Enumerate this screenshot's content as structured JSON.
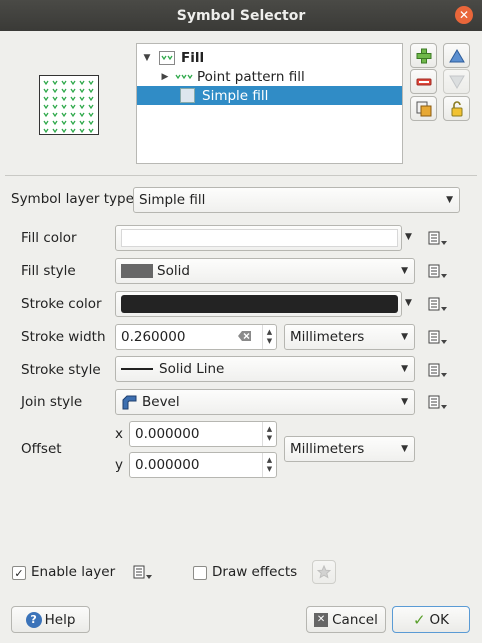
{
  "window": {
    "title": "Symbol Selector",
    "close_icon": "close-icon"
  },
  "tree": {
    "root_label": "Fill",
    "items": [
      {
        "label": "Point pattern fill",
        "icon": "point-pattern-icon"
      },
      {
        "label": "Simple fill",
        "icon": "simple-fill-icon",
        "selected": true
      }
    ]
  },
  "layer_buttons": [
    "add-layer-icon",
    "remove-layer-icon",
    "duplicate-layer-icon",
    "lock-icon",
    "move-up-icon",
    "move-down-icon"
  ],
  "symbol_layer_type": {
    "label": "Symbol layer type",
    "value": "Simple fill"
  },
  "fields": {
    "fill_color": {
      "label": "Fill color",
      "color": "#ffffff"
    },
    "fill_style": {
      "label": "Fill style",
      "value": "Solid",
      "swatch": "#676767"
    },
    "stroke_color": {
      "label": "Stroke color",
      "color": "#232323"
    },
    "stroke_width": {
      "label": "Stroke width",
      "value": "0.260000",
      "unit": "Millimeters"
    },
    "stroke_style": {
      "label": "Stroke style",
      "value": "Solid Line"
    },
    "join_style": {
      "label": "Join style",
      "value": "Bevel"
    },
    "offset": {
      "label": "Offset",
      "x_label": "x",
      "x_value": "0.000000",
      "y_label": "y",
      "y_value": "0.000000",
      "unit": "Millimeters"
    }
  },
  "footer": {
    "enable_layer": {
      "label": "Enable layer",
      "checked": true
    },
    "draw_effects": {
      "label": "Draw effects",
      "checked": false
    },
    "help": "Help",
    "cancel": "Cancel",
    "ok": "OK"
  },
  "colors": {
    "selection": "#308cc6",
    "marker_green": "#2ea84a"
  }
}
